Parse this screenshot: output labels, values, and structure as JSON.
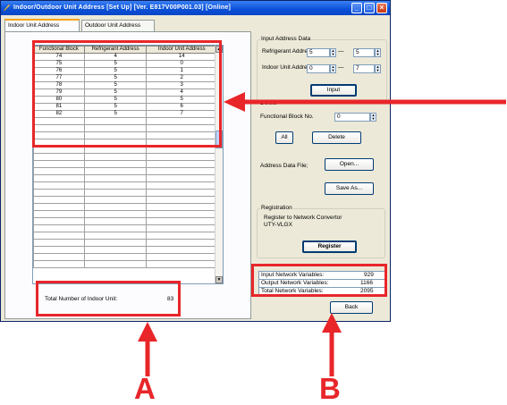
{
  "window": {
    "title": "Indoor/Outdoor Unit Address  [Set Up] [Ver. E817V00P001.03] [Online]",
    "controls": [
      "_",
      "□",
      "×"
    ]
  },
  "tabs": [
    {
      "label": "Indoor Unit Address",
      "active": true
    },
    {
      "label": "Outdoor Unit Address",
      "active": false
    }
  ],
  "grid": {
    "headers": [
      "Functional Block",
      "Refrigerant Address",
      "Indoor Unit Address"
    ],
    "rows": [
      [
        "74",
        "4",
        "14"
      ],
      [
        "75",
        "5",
        "0"
      ],
      [
        "76",
        "5",
        "1"
      ],
      [
        "77",
        "5",
        "2"
      ],
      [
        "78",
        "5",
        "3"
      ],
      [
        "79",
        "5",
        "4"
      ],
      [
        "80",
        "5",
        "5"
      ],
      [
        "81",
        "5",
        "6"
      ],
      [
        "82",
        "5",
        "7"
      ]
    ],
    "empty_rows": 21
  },
  "total": {
    "label": "Total Number of Indoor Unit:",
    "value": "83"
  },
  "input_address": {
    "group_label": "Input Address Data",
    "refrigerant_label": "Refrigerant Address",
    "refrigerant_from": "5",
    "refrigerant_to": "5",
    "indoor_label": "Indoor Unit Address",
    "indoor_from": "0",
    "indoor_to": "7",
    "dash": "—",
    "input_button": "Input"
  },
  "delete": {
    "group_label": "Delete",
    "fb_label": "Functional Block No.",
    "fb_value": "0",
    "all_button": "All",
    "delete_button": "Delete"
  },
  "address_file": {
    "label": "Address Data File;",
    "open_button": "Open...",
    "saveas_button": "Save As..."
  },
  "registration": {
    "group_label": "Registration",
    "text_line1": "Register to Network Convertor",
    "text_line2": "UTY-VLGX",
    "register_button": "Register"
  },
  "network_vars": [
    {
      "label": "Input Network Variables:",
      "value": "929"
    },
    {
      "label": "Output Network Variables:",
      "value": "1166"
    },
    {
      "label": "Total Network Variables:",
      "value": "2095"
    }
  ],
  "back_button": "Back",
  "callouts": {
    "a": "A",
    "b": "B"
  },
  "colors": {
    "highlight": "#e8262a",
    "titlebar": "#0a50d8"
  },
  "icons": [
    "app-icon",
    "minimize-icon",
    "maximize-icon",
    "close-icon",
    "spin-arrow-icon",
    "scroll-arrow-icon"
  ]
}
